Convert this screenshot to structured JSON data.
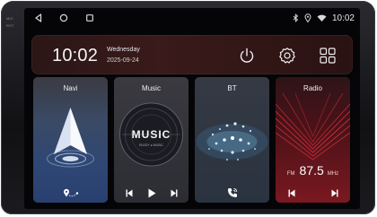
{
  "side_labels": {
    "mic": "MIC",
    "rst": "RST"
  },
  "status_bar": {
    "back_icon": "triangle-left",
    "home_icon": "circle",
    "recents_icon": "square",
    "bluetooth_icon": "bluetooth",
    "location_icon": "location-pin",
    "wifi_icon": "wifi",
    "time": "10:02"
  },
  "header": {
    "time": "10:02",
    "weekday": "Wednesday",
    "date": "2025-09-24",
    "power_icon": "power",
    "settings_icon": "gear",
    "apps_icon": "apps-grid"
  },
  "cards": {
    "navi": {
      "title": "Navi",
      "footer_icon": "route-pin"
    },
    "music": {
      "title": "Music",
      "art_text": "MUSIC",
      "art_subtext": "ENJOY ● MUSIC"
    },
    "bt": {
      "title": "BT",
      "footer_icon": "phone"
    },
    "radio": {
      "title": "Radio",
      "band": "FM",
      "frequency": "87.5",
      "unit": "MHz"
    }
  },
  "colors": {
    "accent_red": "#c0202a",
    "header_bg": "#3a1a1a",
    "text": "#f0f0f2"
  }
}
